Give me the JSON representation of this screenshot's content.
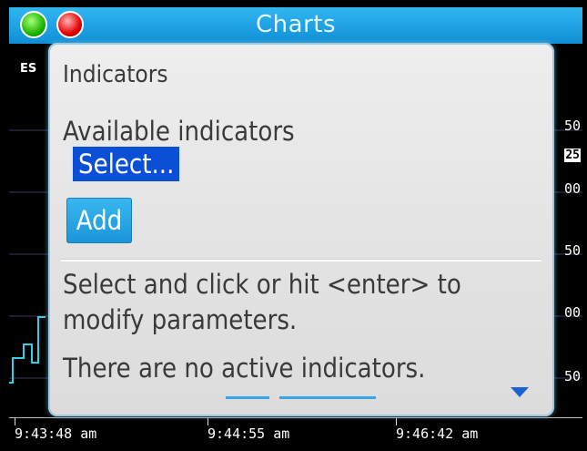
{
  "window": {
    "title": "Charts"
  },
  "chart": {
    "symbol": "ES",
    "y_ticks": [
      "50",
      "25",
      "00",
      "50",
      "00",
      "50"
    ],
    "x_ticks": [
      "9:43:48 am",
      "9:44:55 am",
      "9:46:42 am"
    ],
    "colors": {
      "background": "#000000",
      "price_line": "#2fd0e8",
      "grid": "#3a3a5a"
    }
  },
  "dialog": {
    "title": "Indicators",
    "available_label": "Available indicators",
    "select_value": "Select...",
    "add_label": "Add",
    "help_text": "Select and click or hit <enter> to modify parameters.",
    "no_active_text": "There are no active indicators.",
    "colors": {
      "select_highlight": "#0a4fd6",
      "button": "#1b95d9"
    }
  },
  "icons": {
    "close_lamp": "green-circle-icon",
    "red_lamp": "red-circle-icon",
    "scroll_down": "triangle-down-icon"
  }
}
